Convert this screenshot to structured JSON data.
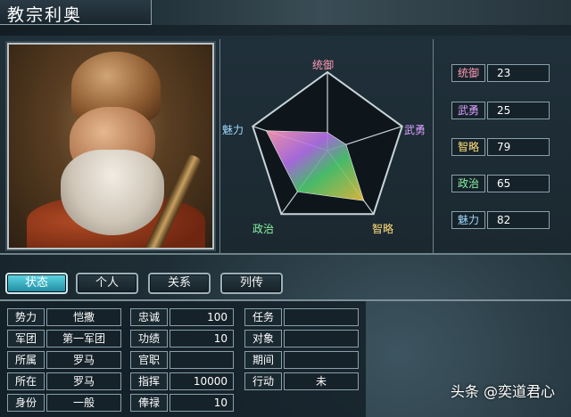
{
  "header": {
    "title": "教宗利奥"
  },
  "radar": {
    "labels": {
      "tongyu": "统御",
      "wuyong": "武勇",
      "zhilue": "智略",
      "zhengzhi": "政治",
      "meili": "魅力"
    },
    "label_colors": {
      "tongyu": "#ff9ab4",
      "wuyong": "#d8a0ff",
      "zhilue": "#ffe07a",
      "zhengzhi": "#86f0a0",
      "meili": "#9fd8ff"
    },
    "values": {
      "tongyu": 23,
      "wuyong": 25,
      "zhilue": 79,
      "zhengzhi": 65,
      "meili": 82
    },
    "max": 100
  },
  "stats": [
    {
      "label": "统御",
      "value": "23",
      "color": "#ff9ab4"
    },
    {
      "label": "武勇",
      "value": "25",
      "color": "#d8a0ff"
    },
    {
      "label": "智略",
      "value": "79",
      "color": "#ffe07a"
    },
    {
      "label": "政治",
      "value": "65",
      "color": "#86f0a0"
    },
    {
      "label": "魅力",
      "value": "82",
      "color": "#9fd8ff"
    }
  ],
  "tabs": [
    "状态",
    "个人",
    "关系",
    "列传"
  ],
  "info": {
    "col1": [
      {
        "label": "势力",
        "value": "恺撒"
      },
      {
        "label": "军团",
        "value": "第一军团"
      },
      {
        "label": "所属",
        "value": "罗马"
      },
      {
        "label": "所在",
        "value": "罗马"
      },
      {
        "label": "身份",
        "value": "一般"
      }
    ],
    "col2": [
      {
        "label": "忠诚",
        "value": "100"
      },
      {
        "label": "功绩",
        "value": "10"
      },
      {
        "label": "官职",
        "value": ""
      },
      {
        "label": "指挥",
        "value": "10000"
      },
      {
        "label": "俸禄",
        "value": "10"
      }
    ],
    "col3": [
      {
        "label": "任务",
        "value": ""
      },
      {
        "label": "对象",
        "value": ""
      },
      {
        "label": "期间",
        "value": ""
      },
      {
        "label": "行动",
        "value": "未"
      }
    ]
  },
  "watermark": "头条 @奕道君心"
}
